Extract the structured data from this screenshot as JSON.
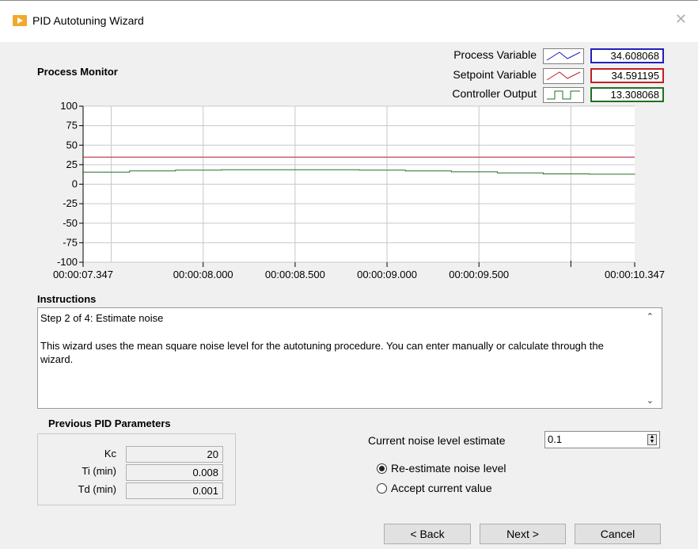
{
  "window": {
    "title": "PID Autotuning Wizard",
    "close_icon": "close-icon",
    "app_icon": "labview-run-icon"
  },
  "monitor": {
    "title": "Process Monitor",
    "legend": [
      {
        "label": "Process Variable",
        "value": "34.608068",
        "color": "#2020c0",
        "swatch": "line-swatch"
      },
      {
        "label": "Setpoint Variable",
        "value": "34.591195",
        "color": "#c02020",
        "swatch": "line-swatch"
      },
      {
        "label": "Controller Output",
        "value": "13.308068",
        "color": "#207020",
        "swatch": "step-swatch"
      }
    ]
  },
  "chart_data": {
    "type": "line",
    "y_ticks": [
      "100",
      "75",
      "50",
      "25",
      "0",
      "-25",
      "-50",
      "-75",
      "-100"
    ],
    "ylim": [
      -100,
      100
    ],
    "x_ticks": [
      "00:00:07.347",
      "00:00:08.000",
      "00:00:08.500",
      "00:00:09.000",
      "00:00:09.500",
      "00:00:10.347"
    ],
    "x_tick_seconds": [
      7.347,
      8.0,
      8.5,
      9.0,
      9.5,
      10.347
    ],
    "x_minor_tick_seconds": [
      10.0
    ],
    "xlim_seconds": [
      7.347,
      10.347
    ],
    "grid": true,
    "series": [
      {
        "name": "Process Variable",
        "color": "#3a3ad8",
        "x": [
          7.347,
          10.347
        ],
        "y": [
          34.6,
          34.6
        ]
      },
      {
        "name": "Setpoint Variable",
        "color": "#d83a3a",
        "x": [
          7.347,
          10.347
        ],
        "y": [
          34.59,
          34.59
        ]
      },
      {
        "name": "Controller Output",
        "color": "#207020",
        "step": true,
        "x": [
          7.347,
          7.6,
          7.85,
          8.1,
          8.35,
          8.6,
          8.85,
          9.1,
          9.35,
          9.6,
          9.85,
          10.1,
          10.347
        ],
        "y": [
          15.5,
          17.0,
          18.0,
          18.5,
          18.5,
          18.5,
          18.0,
          17.0,
          15.8,
          14.5,
          13.2,
          12.8,
          13.3
        ]
      }
    ]
  },
  "instructions": {
    "title": "Instructions",
    "step": "Step 2 of 4:  Estimate noise",
    "body": "This wizard uses the mean square noise level for the autotuning procedure. You can enter manually or calculate through the wizard."
  },
  "previous_params": {
    "title": "Previous PID Parameters",
    "rows": [
      {
        "label": "Kc",
        "value": "20"
      },
      {
        "label": "Ti (min)",
        "value": "0.008"
      },
      {
        "label": "Td (min)",
        "value": "0.001"
      }
    ]
  },
  "noise": {
    "label": "Current noise level estimate",
    "value": "0.1",
    "options": [
      {
        "label": "Re-estimate noise level",
        "selected": true
      },
      {
        "label": "Accept current value",
        "selected": false
      }
    ]
  },
  "buttons": {
    "back": "< Back",
    "next": "Next >",
    "cancel": "Cancel"
  }
}
